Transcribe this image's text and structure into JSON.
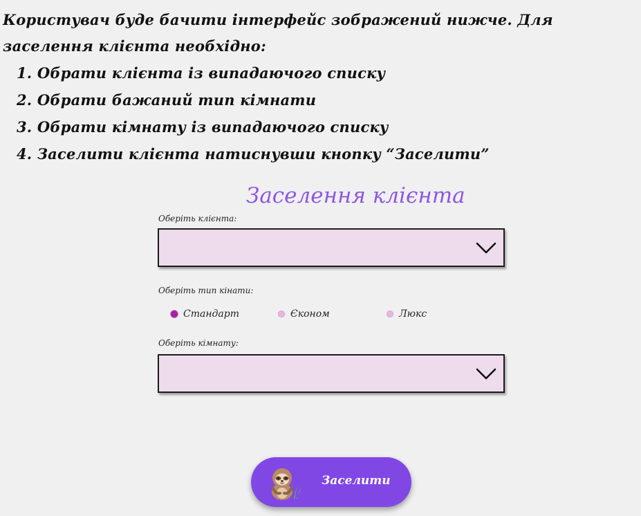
{
  "instructions": {
    "intro": "Користувач буде бачити інтерфейс зображений нижче. Для заселення клієнта необхідно:",
    "steps": [
      "1. Обрати клієнта із випадаючого списку",
      "2. Обрати бажаний тип кімнати",
      "3. Обрати кімнату із випадаючого списку",
      "4. Заселити клієнта натиснувши кнопку “Заселити”"
    ]
  },
  "form": {
    "title": "Заселення клієнта",
    "client_label": "Оберіть клієнта:",
    "client_value": "",
    "room_type_label": "Оберіть тип кінати:",
    "room_types": [
      {
        "label": "Стандарт",
        "checked": true
      },
      {
        "label": "Єконом",
        "checked": false
      },
      {
        "label": "Люкс",
        "checked": false
      }
    ],
    "room_label": "Оберіть кімнату:",
    "room_value": "",
    "submit_label": "Заселити",
    "submit_icon": "sloth-icon"
  },
  "colors": {
    "background": "#f0f0f0",
    "title": "#8d57e0",
    "select_fill": "#eedcec",
    "button": "#8147e5",
    "radio_checked": "#a0249e",
    "radio_unchecked": "#e6b7e0"
  }
}
